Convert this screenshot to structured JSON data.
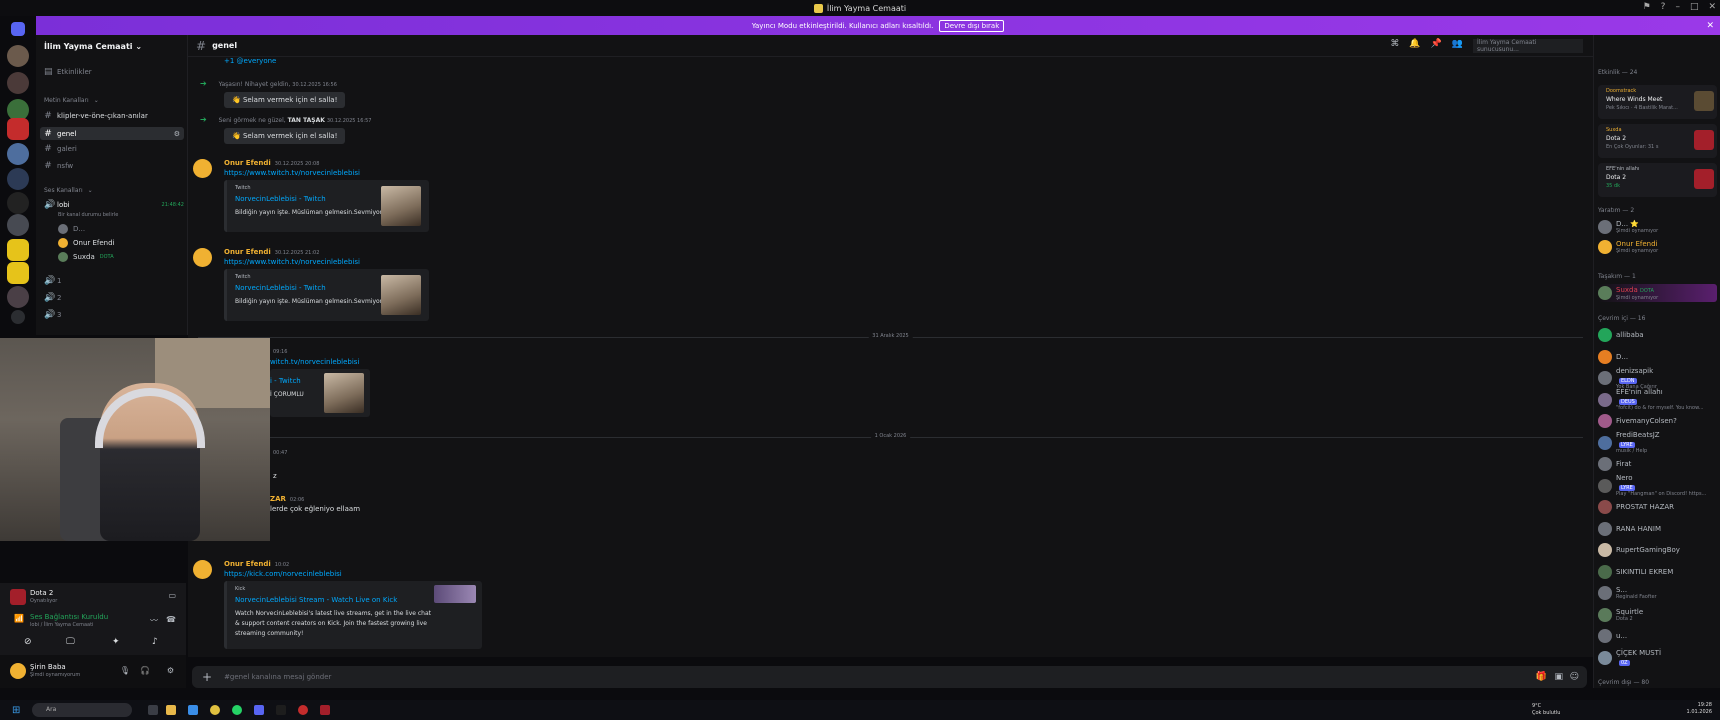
{
  "titlebar": {
    "title": "İlim Yayma Cemaati"
  },
  "banner": {
    "text": "Yayıncı Modu etkinleştirildi. Kullanıcı adları kısaltıldı.",
    "button": "Devre dışı bırak"
  },
  "channel_list": {
    "server_name": "İlim Yayma Cemaati",
    "events": "Etkinlikler",
    "text_category": "Metin Kanalları",
    "channels": [
      "klipler-ve-öne-çıkan-anılar",
      "genel",
      "galeri",
      "nsfw"
    ],
    "voice_category": "Ses Kanalları",
    "lobby": {
      "name": "lobi",
      "timer": "21:48:42",
      "desc": "Bir kanal durumu belirle"
    },
    "voice_users": [
      "D...",
      "Onur Efendi",
      "Suxda"
    ],
    "voice_user_badge": "DOTA",
    "voice_channels": [
      "1",
      "2",
      "3"
    ]
  },
  "chat_header": {
    "channel": "genel"
  },
  "messages": {
    "mention": "+1 @everyone",
    "sys1": {
      "text": "Yaşasın! Nihayet geldin,",
      "name": "",
      "time": "30.12.2025 16:56",
      "wave": "Selam vermek için el salla!"
    },
    "sys2": {
      "text": "Seni görmek ne güzel,",
      "name": "TAN TAŞAK",
      "time": "30.12.2025 16:57",
      "wave": "Selam vermek için el salla!"
    },
    "m1": {
      "author": "Onur Efendi",
      "time": "30.12.2025 20:08",
      "link": "https://www.twitch.tv/norvecinleblebisi",
      "provider": "Twitch",
      "title": "NorvecinLeblebisi - Twitch",
      "desc": "Bildiğin yayın işte. Müslüman gelmesin.Sevmiyorum"
    },
    "m2": {
      "author": "Onur Efendi",
      "time": "30.12.2025 21:02",
      "link": "https://www.twitch.tv/norvecinleblebisi",
      "provider": "Twitch",
      "title": "NorvecinLeblebisi - Twitch",
      "desc": "Bildiğin yayın işte. Müslüman gelmesin.Sevmiyorum"
    },
    "divider1": "31 Aralık 2025",
    "m3": {
      "time": "09:16",
      "link": "witch.tv/norvecinleblebisi",
      "title": "i - Twitch",
      "desc": "İ ÇORUMLU"
    },
    "divider2": "1 Ocak 2026",
    "m4": {
      "time": "00:47",
      "text": "z"
    },
    "m5": {
      "author": "ZAR",
      "time": "02:06",
      "text": "lerde çok eğleniyo ellaam"
    },
    "m6": {
      "author": "Onur Efendi",
      "time": "10:02",
      "link": "https://kick.com/norvecinleblebisi",
      "provider": "Kick",
      "title": "NorvecinLeblebisi Stream - Watch Live on Kick",
      "desc1": "Watch NorvecinLeblebisi's latest live streams, get in the live chat",
      "desc2": "& support content creators on Kick. Join the fastest growing live",
      "desc3": "streaming community!"
    }
  },
  "composer": {
    "placeholder": "#genel kanalına mesaj gönder"
  },
  "voice_panel": {
    "game": "Dota 2",
    "game_status": "Oynatılıyor",
    "conn": "Ses Bağlantısı Kuruldu",
    "conn_sub": "lobi / İlim Yayma Cemaati"
  },
  "user_panel": {
    "name": "Şirin Baba",
    "status": "Şimdi oynamıyorum"
  },
  "members": {
    "activity_header": "Etkinlik — 24",
    "activities": [
      {
        "a1": "Doomstrack",
        "a2": "Where Winds Meet",
        "a3": "Pek Sıkıcı · 4 Bastilik Marat..."
      },
      {
        "a1": "Suxda",
        "a2": "Dota 2",
        "a3": "En Çok Oyunlar: 31 s"
      },
      {
        "a1": "EFE'nin allahı",
        "a2": "Dota 2",
        "a3": "35 dk"
      }
    ],
    "group_yaratim": "Yaratım — 2",
    "yaratim": [
      {
        "name": "D... ⭐",
        "sub": "Şimdi oynamıyor"
      },
      {
        "name": "Onur Efendi",
        "sub": "Şimdi oynamıyor"
      }
    ],
    "group_tasakm": "Taşakım — 1",
    "tasakm": [
      {
        "name": "Suxda",
        "badge": "DOTA",
        "sub": "Şimdi oynamıyor"
      }
    ],
    "group_online": "Çevrim içi — 16",
    "online": [
      {
        "name": "allibaba",
        "sub": ""
      },
      {
        "name": "D...",
        "sub": ""
      },
      {
        "name": "denizsapik",
        "badge": "ELDN",
        "sub": "Yok Bana Çağırır"
      },
      {
        "name": "EFE'nin allahı",
        "badge": "DEUS",
        "sub": "\"fofcit) do & for myself. You know..."
      },
      {
        "name": "FivemanyColsen?",
        "sub": ""
      },
      {
        "name": "FrediBeatsJZ",
        "badge": "LYRE",
        "sub": "musik / Help"
      },
      {
        "name": "Firat",
        "sub": ""
      },
      {
        "name": "Nero",
        "badge": "LYRE",
        "sub": "Play \"Hangman\" on Discord! https..."
      },
      {
        "name": "PROSTAT HAZAR",
        "sub": ""
      },
      {
        "name": "RANA HANIM",
        "sub": ""
      },
      {
        "name": "RupertGamingBoy",
        "sub": ""
      },
      {
        "name": "SIKINTILI EKREM",
        "sub": ""
      },
      {
        "name": "S...",
        "sub": "Reginald Faofter"
      },
      {
        "name": "Squirtle",
        "sub": "Dota 2"
      },
      {
        "name": "u...",
        "sub": ""
      },
      {
        "name": "ÇİÇEK MUSTİ",
        "badge": "0Z",
        "sub": ""
      }
    ],
    "group_offline": "Çevrim dışı — 80"
  },
  "taskbar": {
    "search": "Ara",
    "weather_temp": "9°C",
    "weather_desc": "Çok bulutlu",
    "time": "19:28",
    "date": "1.01.2026"
  },
  "colors": {
    "accent_purple": "#9a39e8",
    "link": "#00a8fc",
    "author": "#f0b132",
    "online": "#23a55a"
  }
}
